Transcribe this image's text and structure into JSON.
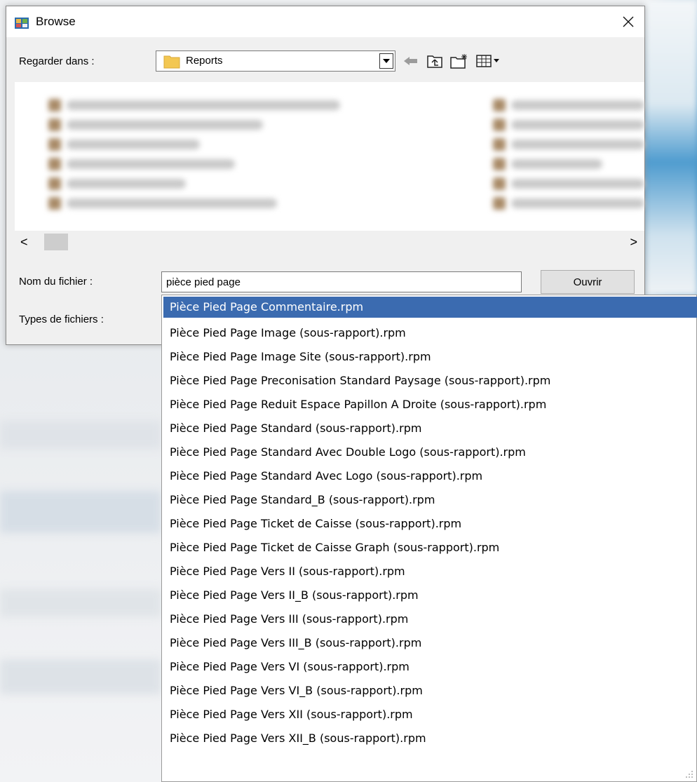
{
  "window": {
    "title": "Browse",
    "close_glyph": "✕"
  },
  "look_in": {
    "label": "Regarder dans :",
    "value": "Reports"
  },
  "toolbar": {
    "icons": [
      "back-arrow-icon",
      "up-folder-icon",
      "new-folder-icon",
      "view-menu-icon"
    ]
  },
  "scroll": {
    "left_glyph": "<",
    "right_glyph": ">"
  },
  "filename": {
    "label": "Nom du fichier :",
    "value": "pièce pied page",
    "open_button": "Ouvrir"
  },
  "file_types": {
    "label": "Types de fichiers :"
  },
  "suggestions": {
    "selected_index": 0,
    "items": [
      "Pièce Pied Page Commentaire.rpm",
      "Pièce Pied Page Image (sous-rapport).rpm",
      "Pièce Pied Page Image Site (sous-rapport).rpm",
      "Pièce Pied Page Preconisation Standard Paysage (sous-rapport).rpm",
      "Pièce Pied Page Reduit Espace Papillon A Droite (sous-rapport).rpm",
      "Pièce Pied Page Standard (sous-rapport).rpm",
      "Pièce Pied Page Standard Avec Double Logo (sous-rapport).rpm",
      "Pièce Pied Page Standard Avec Logo (sous-rapport).rpm",
      "Pièce Pied Page Standard_B (sous-rapport).rpm",
      "Pièce Pied Page Ticket de Caisse (sous-rapport).rpm",
      "Pièce Pied Page Ticket de Caisse Graph (sous-rapport).rpm",
      "Pièce Pied Page Vers II (sous-rapport).rpm",
      "Pièce Pied Page Vers II_B (sous-rapport).rpm",
      "Pièce Pied Page Vers III (sous-rapport).rpm",
      "Pièce Pied Page Vers III_B (sous-rapport).rpm",
      "Pièce Pied Page Vers VI (sous-rapport).rpm",
      "Pièce Pied Page Vers VI_B (sous-rapport).rpm",
      "Pièce Pied Page Vers XII (sous-rapport).rpm",
      "Pièce Pied Page Vers XII_B (sous-rapport).rpm"
    ]
  },
  "colors": {
    "selection": "#3b6bb0",
    "dialog_bg": "#f0f0f0"
  }
}
